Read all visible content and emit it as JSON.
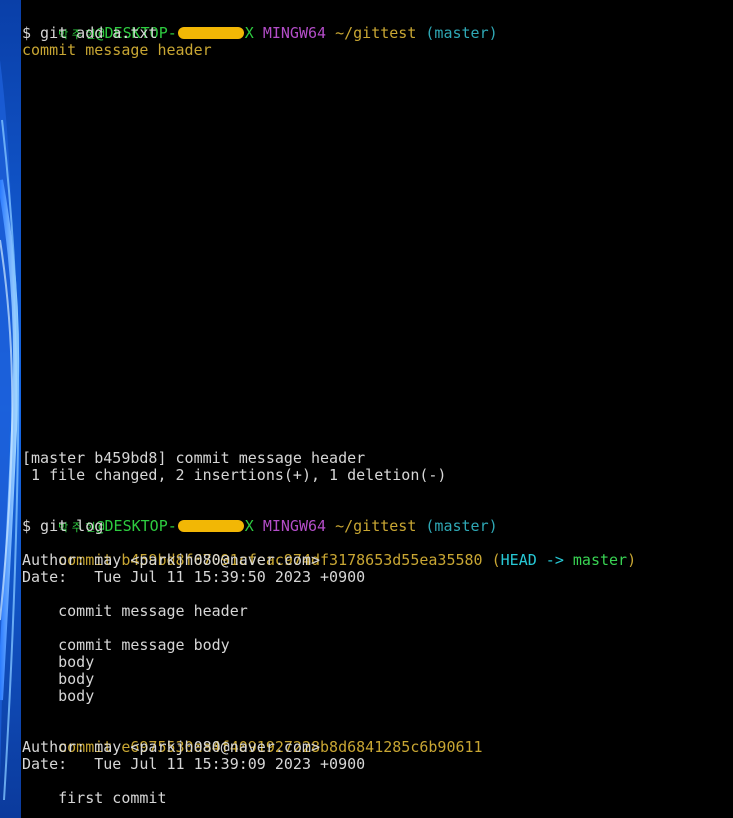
{
  "prompt1": {
    "user": "박 주 현",
    "host_prefix": "@DESKTOP-",
    "host_suffix": "X",
    "shell": "MINGW64",
    "path": "~/gittest",
    "branch": "(master)"
  },
  "cmd1": "$ git add a.txt",
  "echo1": "commit message header",
  "commit_result": {
    "line1": "[master b459bd8] commit message header",
    "line2": " 1 file changed, 2 insertions(+), 1 deletion(-)"
  },
  "prompt2": {
    "user": "박 주 현",
    "host_prefix": "@DESKTOP-",
    "host_suffix": "X",
    "shell": "MINGW64",
    "path": "~/gittest",
    "branch": "(master)"
  },
  "cmd2": "$ git log",
  "log": [
    {
      "commit_label": "commit",
      "hash": "b459bd8f67091cfeac974df3178653d55ea35580",
      "ref_open": "(",
      "ref_head": "HEAD -> ",
      "ref_branch": "master",
      "ref_close": ")",
      "author": "Author: may <parkjh080@naver.com>",
      "date": "Date:   Tue Jul 11 15:39:50 2023 +0900",
      "message": [
        "    commit message header",
        "",
        "    commit message body",
        "    body",
        "    body",
        "    body"
      ]
    },
    {
      "commit_label": "commit",
      "hash": "e6975530aa4f4091927228b8d6841285c6b90611",
      "author": "Author: may <parkjh080@naver.com>",
      "date": "Date:   Tue Jul 11 15:39:09 2023 +0900",
      "message": [
        "    first commit"
      ]
    }
  ],
  "colors": {
    "background": "#000000",
    "text": "#d6d6d6",
    "prompt_user": "#2ecc40",
    "prompt_shell": "#b34dc8",
    "prompt_path": "#c8a633",
    "prompt_branch": "#2fa8b5",
    "commit_hash": "#c8a633",
    "ref_head": "#27c9d6",
    "ref_branch": "#39d353",
    "redaction": "#f2b705"
  },
  "icons": {
    "wallpaper": "windows-11-bloom-wallpaper"
  }
}
